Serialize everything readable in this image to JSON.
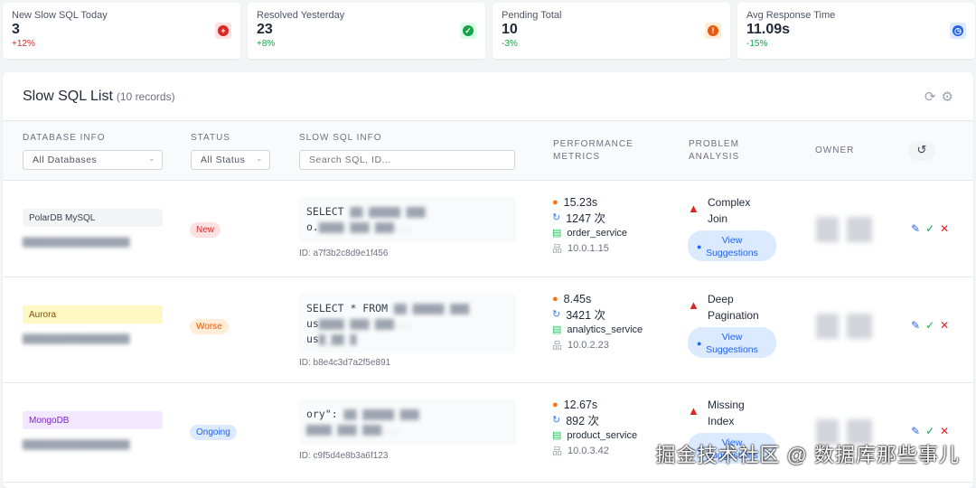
{
  "stats": [
    {
      "label": "New Slow SQL Today",
      "value": "3",
      "change": "+12%",
      "change_color": "#dc2626",
      "icon": "plus-circle-icon",
      "icon_color": "#dc2626",
      "icon_bg": "#fee2e2",
      "glyph": "+"
    },
    {
      "label": "Resolved Yesterday",
      "value": "23",
      "change": "+8%",
      "change_color": "#16a34a",
      "icon": "check-circle-icon",
      "icon_color": "#16a34a",
      "icon_bg": "#dcfce7",
      "glyph": "✓"
    },
    {
      "label": "Pending Total",
      "value": "10",
      "change": "-3%",
      "change_color": "#16a34a",
      "icon": "warning-icon",
      "icon_color": "#ea580c",
      "icon_bg": "#ffedd5",
      "glyph": "!"
    },
    {
      "label": "Avg Response Time",
      "value": "11.09s",
      "change": "-15%",
      "change_color": "#16a34a",
      "icon": "clock-icon",
      "icon_color": "#2563eb",
      "icon_bg": "#dbeafe",
      "glyph": "◷"
    }
  ],
  "list": {
    "title": "Slow SQL List",
    "count": "(10 records)"
  },
  "headers": {
    "db": "DATABASE INFO",
    "status": "STATUS",
    "sql": "SLOW SQL INFO",
    "perf1": "PERFORMANCE",
    "perf2": "METRICS",
    "prob1": "PROBLEM",
    "prob2": "ANALYSIS",
    "owner": "OWNER"
  },
  "filters": {
    "db": "All Databases",
    "status": "All Status",
    "search_placeholder": "Search SQL, ID..."
  },
  "rows": [
    {
      "db": "PolarDB MySQL",
      "db_bg": "#f3f4f6",
      "db_color": "#374151",
      "status": "New",
      "status_bg": "#fee2e2",
      "status_color": "#dc2626",
      "sql1": "SELECT",
      "sql2": "o.",
      "id": "ID: a7f3b2c8d9e1f456",
      "time": "15.23s",
      "count": "1247 次",
      "service": "order_service",
      "ip": "10.0.1.15",
      "problem1": "Complex",
      "problem2": "Join",
      "suggest1": "View",
      "suggest2": "Suggestions"
    },
    {
      "db": "Aurora",
      "db_bg": "#fef9c3",
      "db_color": "#854d0e",
      "status": "Worse",
      "status_bg": "#ffedd5",
      "status_color": "#ea580c",
      "sql1": "SELECT * FROM",
      "sql2": "us",
      "sql3": "us",
      "id": "ID: b8e4c3d7a2f5e891",
      "time": "8.45s",
      "count": "3421 次",
      "service": "analytics_service",
      "ip": "10.0.2.23",
      "problem1": "Deep",
      "problem2": "Pagination",
      "suggest1": "View",
      "suggest2": "Suggestions"
    },
    {
      "db": "MongoDB",
      "db_bg": "#f3e8ff",
      "db_color": "#7e22ce",
      "status": "Ongoing",
      "status_bg": "#dbeafe",
      "status_color": "#2563eb",
      "sql1": "ory\":",
      "sql2": "",
      "id": "ID: c9f5d4e8b3a6f123",
      "time": "12.67s",
      "count": "892 次",
      "service": "product_service",
      "ip": "10.0.3.42",
      "problem1": "Missing",
      "problem2": "Index",
      "suggest1": "View",
      "suggest2": "Suggestions"
    }
  ],
  "watermark": "掘金技术社区 @ 数据库那些事儿"
}
